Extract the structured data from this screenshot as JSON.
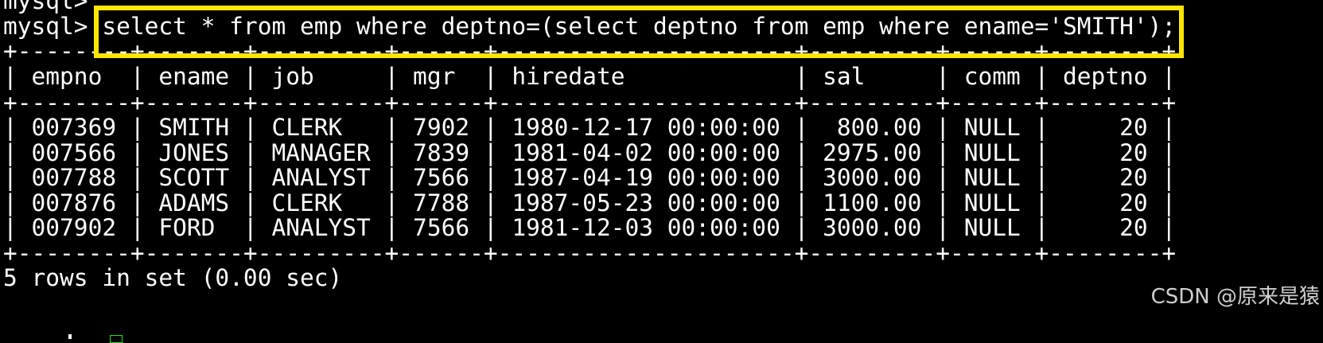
{
  "terminal": {
    "lines": [
      "mysql>",
      "mysql> select * from emp where deptno=(select deptno from emp where ename='SMITH');",
      "+--------+-------+---------+------+---------------------+---------+------+--------+",
      "| empno  | ename | job     | mgr  | hiredate            | sal     | comm | deptno |",
      "+--------+-------+---------+------+---------------------+---------+------+--------+",
      "| 007369 | SMITH | CLERK   | 7902 | 1980-12-17 00:00:00 |  800.00 | NULL |     20 |",
      "| 007566 | JONES | MANAGER | 7839 | 1981-04-02 00:00:00 | 2975.00 | NULL |     20 |",
      "| 007788 | SCOTT | ANALYST | 7566 | 1987-04-19 00:00:00 | 3000.00 | NULL |     20 |",
      "| 007876 | ADAMS | CLERK   | 7788 | 1987-05-23 00:00:00 | 1100.00 | NULL |     20 |",
      "| 007902 | FORD  | ANALYST | 7566 | 1981-12-03 00:00:00 | 3000.00 | NULL |     20 |",
      "+--------+-------+---------+------+---------------------+---------+------+--------+",
      "5 rows in set (0.00 sec)"
    ]
  },
  "watermark": "CSDN @原来是猿",
  "colors": {
    "background": "#000000",
    "text": "#ffffff",
    "highlight": "#ffe600",
    "cursor": "#22dd22"
  }
}
